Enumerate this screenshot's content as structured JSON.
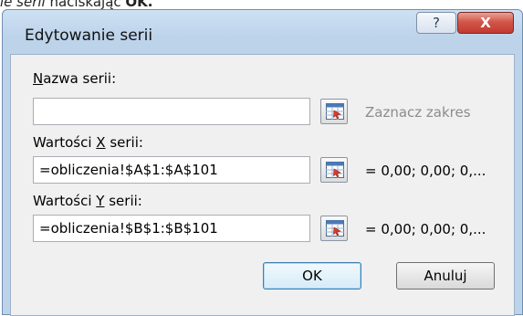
{
  "caption": {
    "italic": "ie serii",
    "normal": " naciskając ",
    "bold": "OK."
  },
  "window": {
    "title": "Edytowanie serii",
    "help_label": "?",
    "close_label": "X"
  },
  "fields": {
    "name": {
      "label_pre": "",
      "label_access": "N",
      "label_post": "azwa serii:",
      "value": "",
      "preview": "Zaznacz zakres"
    },
    "x": {
      "label_pre": "Wartości ",
      "label_access": "X",
      "label_post": " serii:",
      "value": "=obliczenia!$A$1:$A$101",
      "preview": "= 0,00; 0,00; 0,..."
    },
    "y": {
      "label_pre": "Wartości ",
      "label_access": "Y",
      "label_post": " serii:",
      "value": "=obliczenia!$B$1:$B$101",
      "preview": "= 0,00; 0,00; 0,..."
    }
  },
  "buttons": {
    "ok": "OK",
    "cancel": "Anuluj"
  },
  "colors": {
    "title_bar": "#bcd3ea",
    "close_button": "#c23b2f",
    "default_button_border": "#3c7fb1"
  }
}
